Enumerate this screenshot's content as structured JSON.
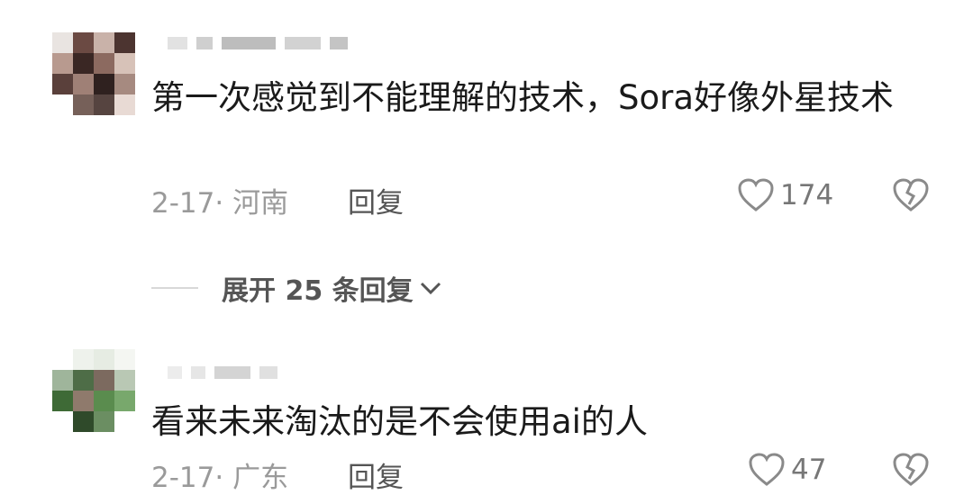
{
  "comments": [
    {
      "text": "第一次感觉到不能理解的技术，Sora好像外星技术",
      "date_location": "2-17· 河南",
      "reply_label": "回复",
      "likes": "174"
    },
    {
      "text": "看来未来淘汰的是不会使用ai的人",
      "date_location": "2-17· 广东",
      "reply_label": "回复",
      "likes": "47"
    }
  ],
  "expand_replies": {
    "label": "展开 25 条回复"
  },
  "colors": {
    "text": "#1a1a1a",
    "meta": "#9a9a9a",
    "icon": "#8a8a8a"
  },
  "icons": [
    "heart-icon",
    "broken-heart-icon",
    "chevron-down-icon"
  ]
}
